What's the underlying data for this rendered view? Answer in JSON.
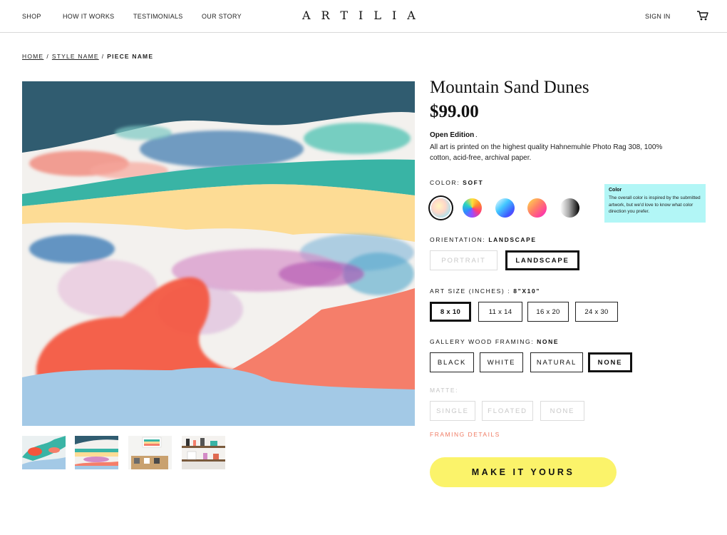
{
  "header": {
    "nav": [
      "SHOP",
      "HOW IT WORKS",
      "TESTIMONIALS",
      "OUR STORY"
    ],
    "logo": "ARTILIA",
    "signin": "SIGN IN",
    "cart_icon": "cart-icon"
  },
  "breadcrumb": {
    "home": "HOME",
    "style": "STYLE NAME",
    "piece": "PIECE NAME",
    "separator": "/"
  },
  "product": {
    "title": "Mountain Sand Dunes",
    "price": "$99.00",
    "edition": "Open Edition",
    "edition_suffix": ".",
    "description": "All art is printed on the highest quality Hahnemuhle Photo Rag 308, 100% cotton, acid-free, archival paper."
  },
  "color": {
    "label": "COLOR:",
    "value": "SOFT",
    "swatches": [
      "soft",
      "rainbow",
      "cool",
      "warm",
      "mono"
    ],
    "tooltip_title": "Color",
    "tooltip_text": "The overall color is inspired by the submitted artwork, but we'd love to know what color direction you prefer."
  },
  "orientation": {
    "label": "ORIENTATION:",
    "value": "LANDSCAPE",
    "options": [
      "PORTRAIT",
      "LANDSCAPE"
    ]
  },
  "size": {
    "label": "ART SIZE (INCHES) :",
    "value": "8”x10”",
    "options": [
      "8 x 10",
      "11 x 14",
      "16 x 20",
      "24 x 30"
    ]
  },
  "framing": {
    "label": "GALLERY WOOD FRAMING:",
    "value": "NONE",
    "options": [
      "BLACK",
      "WHITE",
      "NATURAL",
      "NONE"
    ]
  },
  "matte": {
    "label": "MATTE:",
    "options": [
      "SINGLE",
      "FLOATED",
      "NONE"
    ]
  },
  "framing_details": "FRAMING DETAILS",
  "cta": "MAKE IT YOURS",
  "colors": {
    "accent_yellow": "#fbf36a",
    "tooltip_bg": "#b2f6f6",
    "link_coral": "#f07b63",
    "art_navy": "#305c70",
    "art_teal": "#39b4a5",
    "art_sand": "#fddc95",
    "art_red": "#f4553c",
    "art_sky": "#a3c9e6",
    "art_salmon": "#f57e6a"
  }
}
